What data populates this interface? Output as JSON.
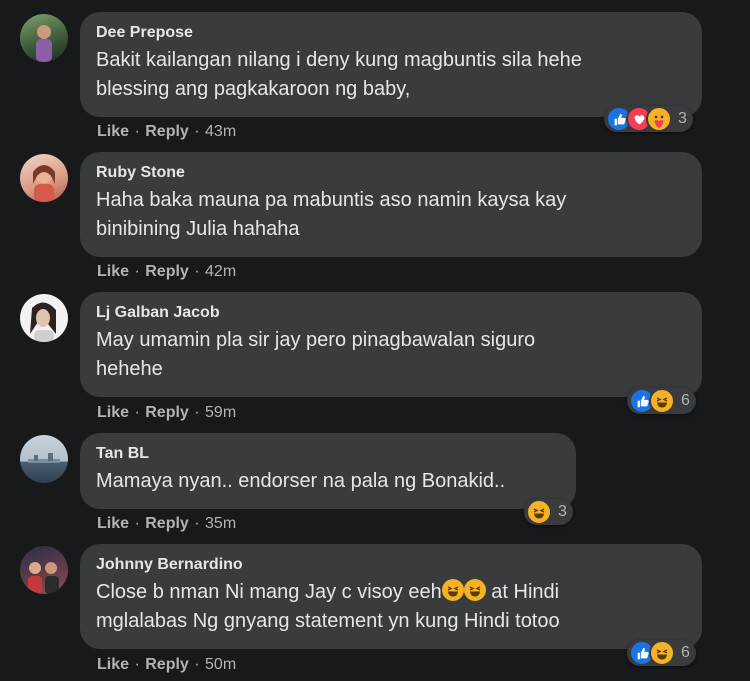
{
  "comments": [
    {
      "author": "Dee Prepose",
      "lines": [
        "Bakit kailangan nilang i deny kung magbuntis sila hehe",
        "blessing ang pagkakaroon ng baby,"
      ],
      "like": "Like",
      "reply": "Reply",
      "time": "43m",
      "reaction_icons": [
        "like-icon",
        "love-icon",
        "care-icon"
      ],
      "reaction_count": "3",
      "avatar_colors": [
        "#6b8f5a",
        "#2c3e2f"
      ]
    },
    {
      "author": "Ruby Stone",
      "lines": [
        "Haha baka mauna pa mabuntis aso namin kaysa kay",
        "binibining Julia hahaha"
      ],
      "like": "Like",
      "reply": "Reply",
      "time": "42m",
      "avatar_colors": [
        "#e8b9a0",
        "#c44a3c"
      ]
    },
    {
      "author": "Lj Galban Jacob",
      "lines": [
        "May umamin pla sir jay pero pinagbawalan siguro",
        "hehehe"
      ],
      "like": "Like",
      "reply": "Reply",
      "time": "59m",
      "reaction_icons": [
        "like-icon",
        "haha-icon"
      ],
      "reaction_count": "6",
      "avatar_colors": [
        "#f2f2f2",
        "#3b2a25"
      ]
    },
    {
      "author": "Tan BL",
      "lines": [
        "Mamaya nyan.. endorser na pala ng Bonakid.."
      ],
      "like": "Like",
      "reply": "Reply",
      "time": "35m",
      "reaction_icons": [
        "haha-icon"
      ],
      "reaction_count": "3",
      "avatar_colors": [
        "#b8c4cf",
        "#3d5468"
      ]
    },
    {
      "author": "Johnny Bernardino",
      "line1_pre": "Close b nman Ni mang Jay c visoy eeh",
      "line1_post": " at Hindi",
      "line2": "mglalabas Ng gnyang statement yn kung Hindi totoo",
      "inline_emoji": "haha-icon",
      "like": "Like",
      "reply": "Reply",
      "time": "50m",
      "reaction_icons": [
        "like-icon",
        "haha-icon"
      ],
      "reaction_count": "6",
      "avatar_colors": [
        "#9a4a5a",
        "#2a2f45"
      ]
    }
  ],
  "colors": {
    "background": "#18191a",
    "bubble": "#3a3b3c",
    "text": "#e4e6eb",
    "meta": "#b0b3b8",
    "like_blue": "#1b74e4",
    "love_red": "#f33e58",
    "haha_yellow": "#f7b125"
  }
}
